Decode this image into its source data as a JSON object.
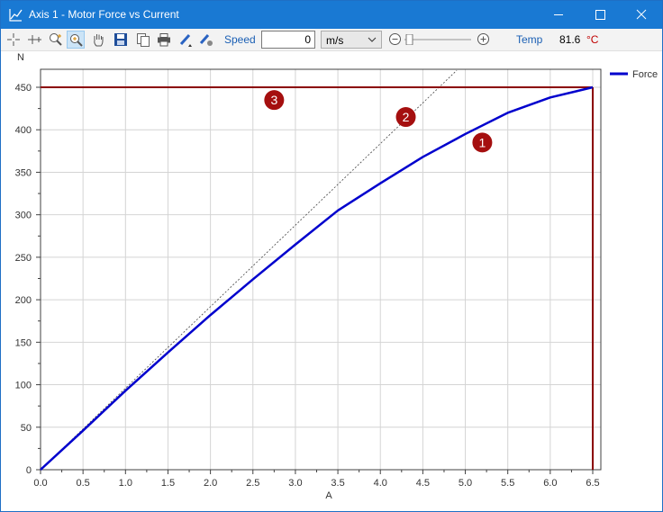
{
  "window": {
    "title": "Axis 1 - Motor Force vs Current",
    "minimize_glyph": "—",
    "maximize_glyph": "☐",
    "close_glyph": "✕"
  },
  "toolbar": {
    "icons": [
      "crosshair-icon",
      "move-cursor-icon",
      "zoom-icon",
      "zoom-select-icon",
      "pan-hand-icon",
      "save-icon",
      "copy-icon",
      "print-icon",
      "pen-icon",
      "pen-settings-icon"
    ],
    "speed_label": "Speed",
    "speed_value": "0",
    "speed_unit": "m/s",
    "speed_slider_level": 0.0,
    "temp_label": "Temp",
    "temp_value": "81.6",
    "temp_unit": "°C"
  },
  "colors": {
    "title_bar": "#1979d3",
    "series": "#0000cd",
    "limit_line": "#8b0000",
    "marker": "#a50f0f",
    "toolbar_blue": "#1a5fb4"
  },
  "chart_data": {
    "type": "line",
    "title": "",
    "xlabel": "A",
    "ylabel": "N",
    "xlim": [
      0,
      6.5
    ],
    "ylim": [
      0,
      450
    ],
    "x_ticks": [
      "0.0",
      "0.5",
      "1.0",
      "1.5",
      "2.0",
      "2.5",
      "3.0",
      "3.5",
      "4.0",
      "4.5",
      "5.0",
      "5.5",
      "6.0",
      "6.5"
    ],
    "y_ticks": [
      "0",
      "50",
      "100",
      "150",
      "200",
      "250",
      "300",
      "350",
      "400",
      "450"
    ],
    "grid": true,
    "legend_position": "top-right",
    "series": [
      {
        "name": "Force",
        "x": [
          0,
          0.5,
          1.0,
          1.5,
          2.0,
          2.5,
          3.0,
          3.5,
          4.0,
          4.5,
          5.0,
          5.5,
          6.0,
          6.5
        ],
        "y": [
          0,
          46,
          93,
          138,
          182,
          224,
          265,
          305,
          337,
          368,
          395,
          420,
          438,
          450
        ]
      }
    ],
    "reference_line": {
      "x": [
        0,
        4.9
      ],
      "y": [
        0,
        470
      ],
      "style": "dotted"
    },
    "limit_lines": {
      "horizontal_y": 450,
      "vertical_x": 6.5
    },
    "annotations": [
      {
        "label": "1",
        "x": 5.2,
        "y": 385
      },
      {
        "label": "2",
        "x": 4.3,
        "y": 415
      },
      {
        "label": "3",
        "x": 2.75,
        "y": 435
      }
    ]
  }
}
